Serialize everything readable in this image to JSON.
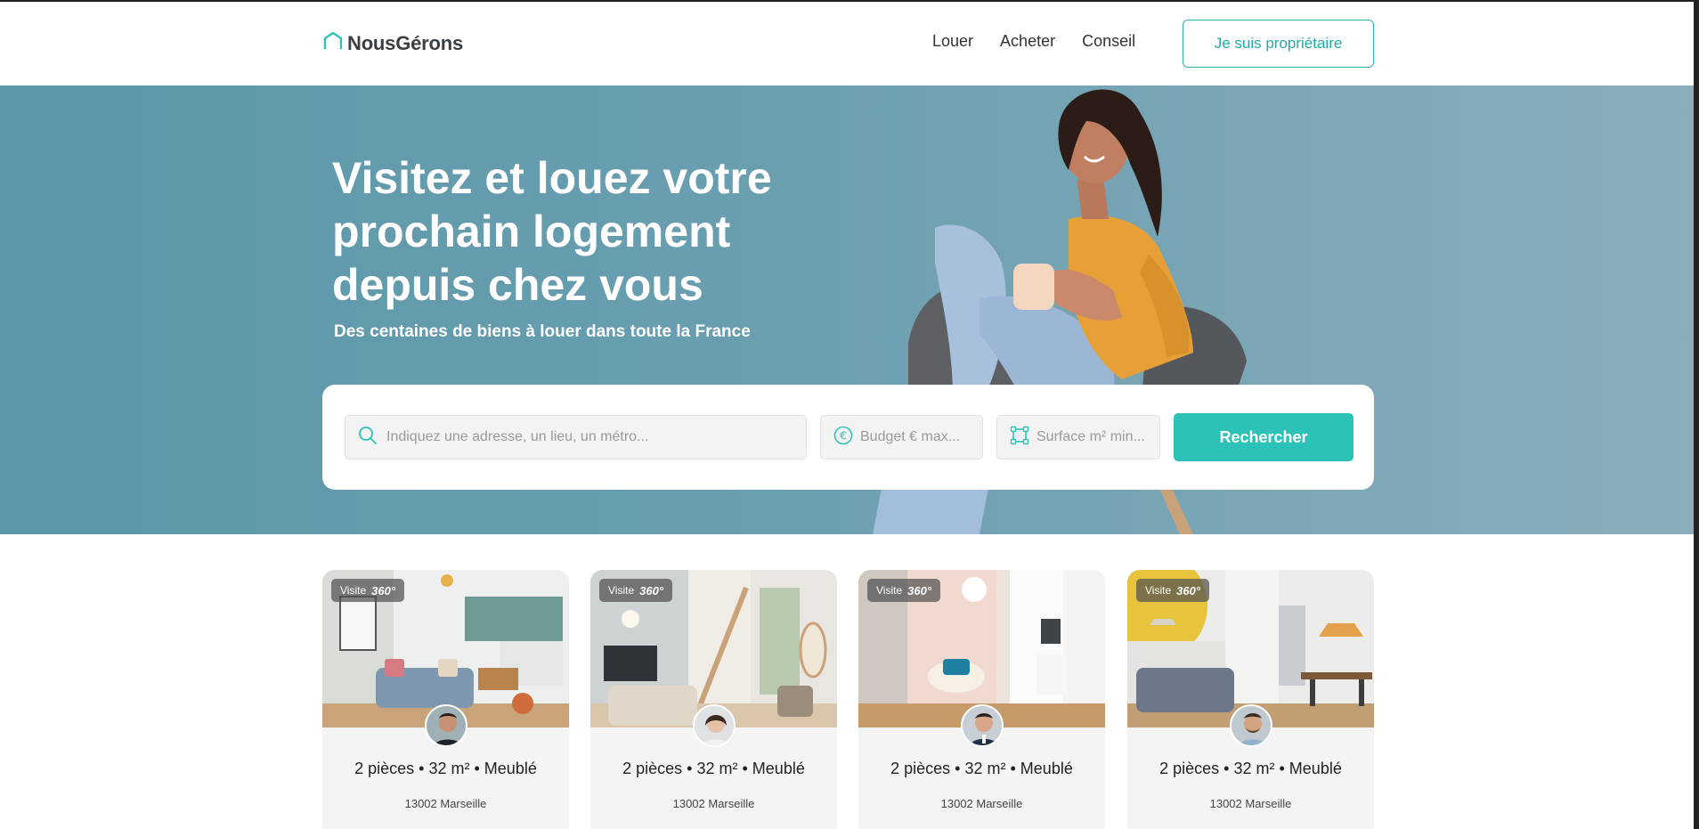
{
  "header": {
    "logo_text": "NousGérons",
    "nav": [
      "Louer",
      "Acheter",
      "Conseil"
    ],
    "owner_button": "Je suis propriétaire"
  },
  "hero": {
    "title_lines": [
      "Visitez et louez votre",
      "prochain logement",
      "depuis chez vous"
    ],
    "subtitle": "Des centaines de biens à louer dans toute la France"
  },
  "search": {
    "address_placeholder": "Indiquez une adresse, un lieu, un métro...",
    "budget_placeholder": "Budget € max...",
    "surface_placeholder": "Surface m² min...",
    "button": "Rechercher"
  },
  "listings": [
    {
      "badge_text": "Visite",
      "badge_360": "360°",
      "title": "2 pièces • 32 m² • Meublé",
      "location": "13002 Marseille"
    },
    {
      "badge_text": "Visite",
      "badge_360": "360°",
      "title": "2 pièces • 32 m² • Meublé",
      "location": "13002 Marseille"
    },
    {
      "badge_text": "Visite",
      "badge_360": "360°",
      "title": "2 pièces • 32 m² • Meublé",
      "location": "13002 Marseille"
    },
    {
      "badge_text": "Visite",
      "badge_360": "360°",
      "title": "2 pièces • 32 m² • Meublé",
      "location": "13002 Marseille"
    }
  ],
  "colors": {
    "accent": "#2cc2b8",
    "hero_bg": "#6a9fb0",
    "card_bg": "#f4f4f4"
  }
}
